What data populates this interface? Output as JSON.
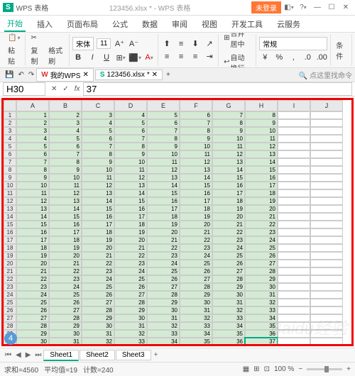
{
  "titlebar": {
    "app_name": "WPS 表格",
    "doc_title": "123456.xlsx * - WPS 表格",
    "login": "未登录"
  },
  "menu": {
    "start": "开始",
    "insert": "插入",
    "layout": "页面布局",
    "formula": "公式",
    "data": "数据",
    "review": "审阅",
    "view": "视图",
    "dev": "开发工具",
    "cloud": "云服务"
  },
  "toolbar": {
    "paste": "粘贴",
    "copy": "复制",
    "format_painter": "格式刷",
    "font_name": "宋体",
    "font_size": "11",
    "merge": "合并居中",
    "wrap": "自动换行",
    "general": "常规",
    "cond": "条件"
  },
  "doctabs": {
    "mywps": "我的WPS",
    "file": "123456.xlsx",
    "search_hint": "点这里找命令"
  },
  "formula": {
    "name_box": "H30",
    "fx": "fx",
    "value": "37"
  },
  "columns": [
    "A",
    "B",
    "C",
    "D",
    "E",
    "F",
    "G",
    "H",
    "I",
    "J"
  ],
  "rows_count": 33,
  "data_rows": 30,
  "data_cols": 8,
  "selected": {
    "row": 30,
    "col": 8
  },
  "sheet_tabs": {
    "s1": "Sheet1",
    "s2": "Sheet2",
    "s3": "Sheet3"
  },
  "status": {
    "sum": "求和=4560",
    "avg": "平均值=19",
    "count": "计数=240",
    "zoom": "100 %"
  },
  "step": "4",
  "watermark": "Baidu经验"
}
